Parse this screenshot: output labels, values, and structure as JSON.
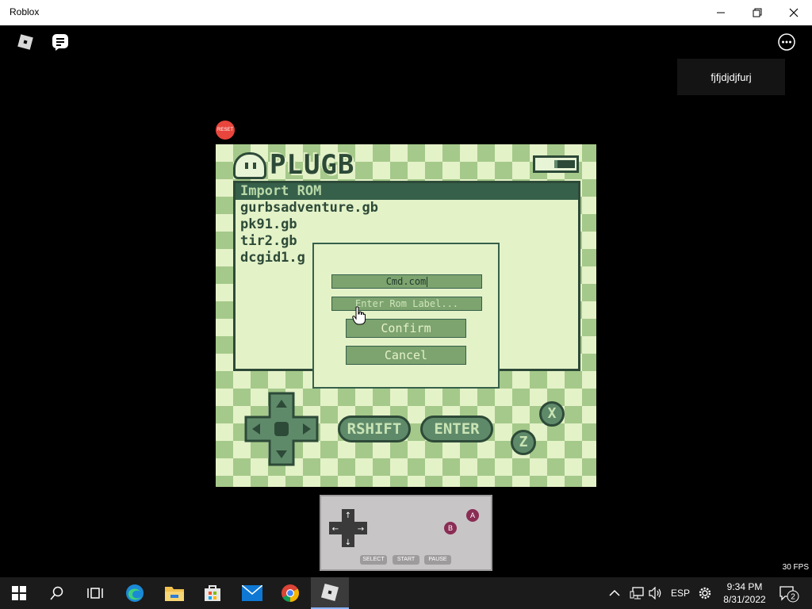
{
  "window": {
    "title": "Roblox"
  },
  "game": {
    "player_name": "fjfjdjdjfurj",
    "reset_label": "RESET",
    "fps": "30 FPS"
  },
  "emulator": {
    "logo": "PLUGB",
    "rom_list": [
      "Import ROM",
      "gurbsadventure.gb",
      "pk91.gb",
      "tir2.gb",
      "dcgid1.g"
    ],
    "dialog": {
      "rom_name_value": "Cmd.com",
      "rom_label_placeholder": "Enter Rom Label...",
      "confirm_label": "Confirm",
      "cancel_label": "Cancel"
    },
    "controls": {
      "rshift_label": "RSHIFT",
      "enter_label": "ENTER",
      "x_label": "X",
      "z_label": "Z"
    }
  },
  "gamepad": {
    "a_label": "A",
    "b_label": "B",
    "select_label": "SELECT",
    "start_label": "START",
    "pause_label": "PAUSE"
  },
  "taskbar": {
    "language": "ESP",
    "time": "9:34 PM",
    "date": "8/31/2022",
    "notification_count": "2"
  }
}
